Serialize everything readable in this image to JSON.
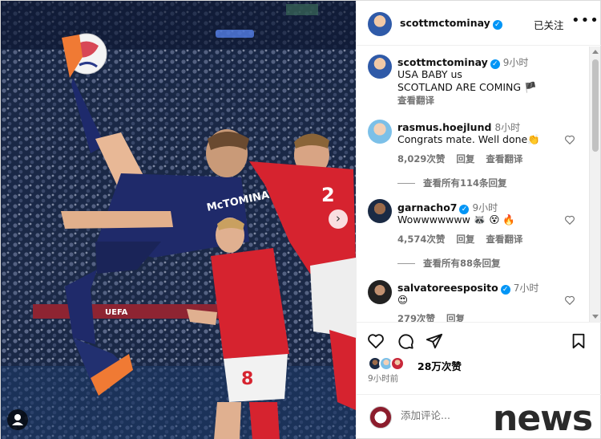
{
  "post": {
    "username": "scottmctominay",
    "follow_label": "已关注",
    "more_label": "•••",
    "next_label": "›"
  },
  "caption": {
    "username": "scottmctominay",
    "time": "9小时",
    "line1": "USA BABY us",
    "line2": "SCOTLAND ARE COMING 🏴",
    "translate": "查看翻译"
  },
  "comments": [
    {
      "username": "rasmus.hoejlund",
      "time": "8小时",
      "text": "Congrats mate. Well done👏",
      "likes": "8,029次赞",
      "reply": "回复",
      "translate": "查看翻译",
      "view_replies": "查看所有114条回复"
    },
    {
      "username": "garnacho7",
      "time": "9小时",
      "text": "Wowwwwwww 🦝 😵 🔥",
      "likes": "4,574次赞",
      "reply": "回复",
      "translate": "查看翻译",
      "view_replies": "查看所有88条回复"
    },
    {
      "username": "salvatoreesposito",
      "time": "7小时",
      "text": "😍",
      "likes": "279次赞",
      "reply": "回复"
    }
  ],
  "footer": {
    "likes": "28万次赞",
    "posted": "9小时前",
    "comment_placeholder": "添加评论..."
  },
  "photo_text": {
    "jersey_name": "McTOMINAY",
    "jersey_number_red": "2",
    "jersey_number_red2": "8",
    "ad_board": "UEFA"
  },
  "watermark": "news",
  "icons": [
    "verified-icon",
    "heart-icon",
    "comment-icon",
    "share-icon",
    "bookmark-icon",
    "user-tag-icon"
  ]
}
